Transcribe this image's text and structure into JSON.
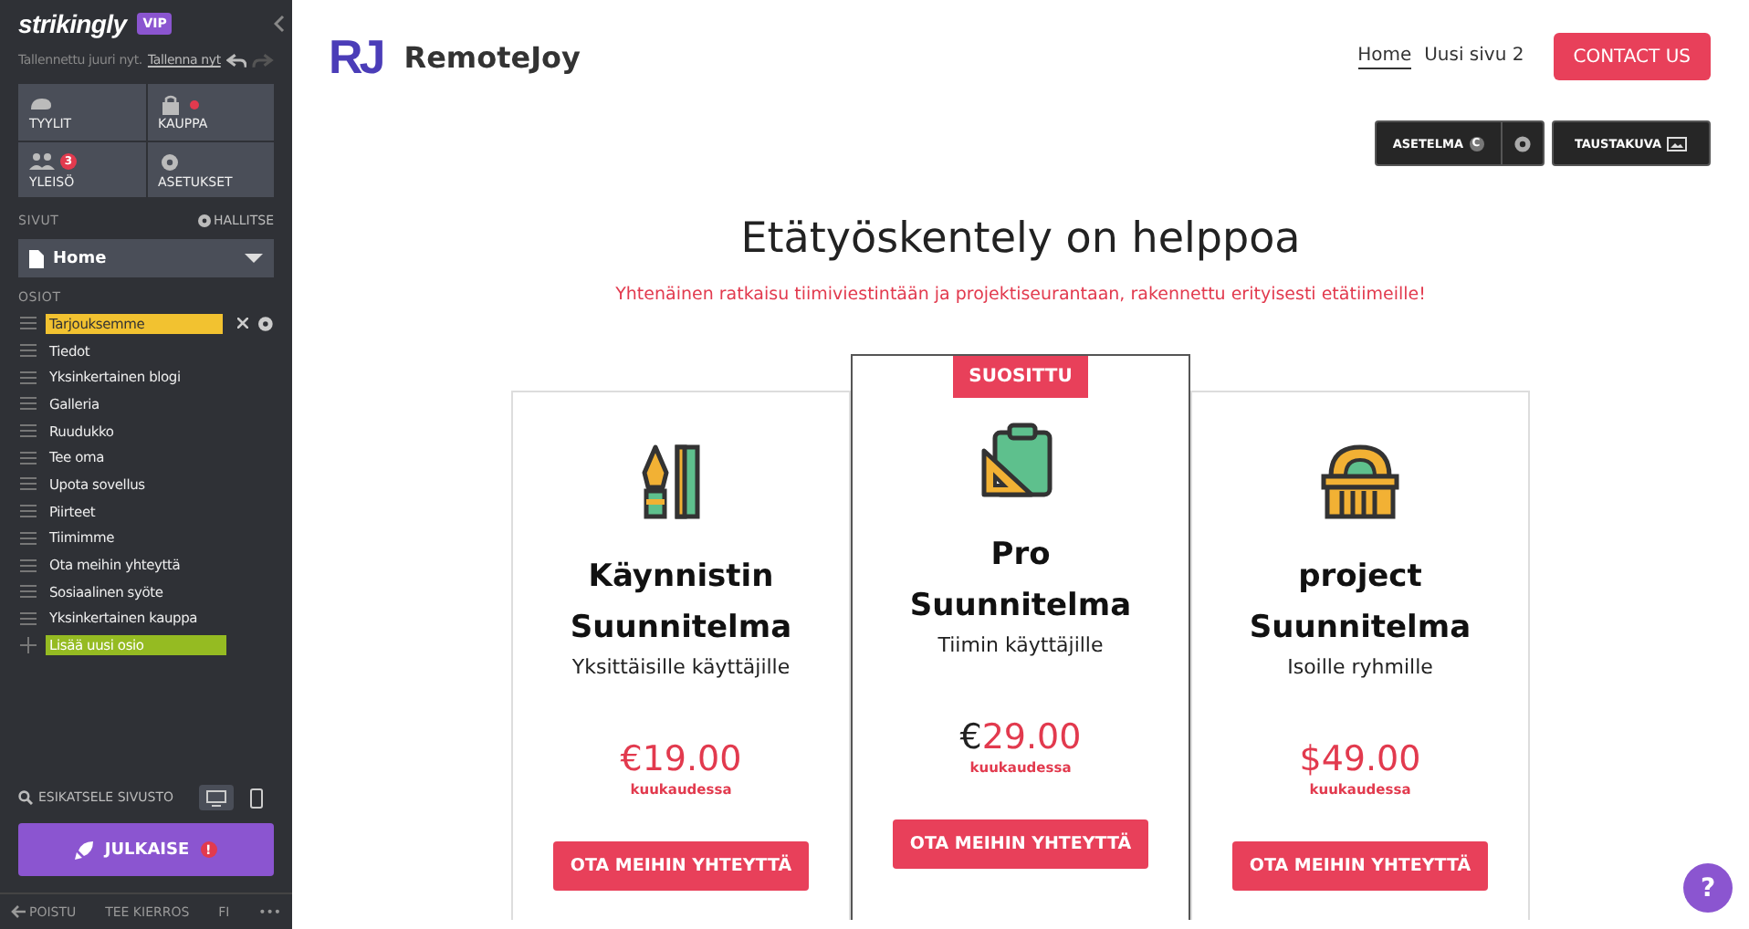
{
  "sidebar": {
    "logo": "strikingly",
    "badge": "VIP",
    "save_status": "Tallennettu juuri nyt.",
    "save_link": "Tallenna nyt",
    "tiles": [
      {
        "kind": "styles",
        "label": "TYYLIT"
      },
      {
        "kind": "store",
        "label": "KAUPPA",
        "dot": true
      },
      {
        "kind": "audience",
        "label": "YLEISÖ",
        "count": "3"
      },
      {
        "kind": "settings",
        "label": "ASETUKSET"
      }
    ],
    "pages_label": "SIVUT",
    "manage_label": "HALLITSE",
    "page_select": "Home",
    "sections_label": "OSIOT",
    "sections": [
      {
        "kind": "section",
        "label": "Tarjouksemme",
        "selected": true
      },
      {
        "kind": "section",
        "label": "Tiedot",
        "selected": false
      },
      {
        "kind": "section",
        "label": "Yksinkertainen blogi",
        "selected": false
      },
      {
        "kind": "section",
        "label": "Galleria",
        "selected": false
      },
      {
        "kind": "section",
        "label": "Ruudukko",
        "selected": false
      },
      {
        "kind": "section",
        "label": "Tee oma",
        "selected": false
      },
      {
        "kind": "section",
        "label": "Upota sovellus",
        "selected": false
      },
      {
        "kind": "section",
        "label": "Piirteet",
        "selected": false
      },
      {
        "kind": "section",
        "label": "Tiimimme",
        "selected": false
      },
      {
        "kind": "section",
        "label": "Ota meihin yhteyttä",
        "selected": false
      },
      {
        "kind": "section",
        "label": "Sosiaalinen syöte",
        "selected": false
      },
      {
        "kind": "section",
        "label": "Yksinkertainen kauppa",
        "selected": false
      },
      {
        "kind": "add",
        "label": "Lisää uusi osio"
      }
    ],
    "preview_label": "ESIKATSELE SIVUSTO",
    "devices": [
      {
        "kind": "desktop",
        "selected": true
      },
      {
        "kind": "mobile",
        "selected": false
      }
    ],
    "publish": "JULKAISE",
    "publish_alert": "!",
    "footer": [
      {
        "kind": "exit",
        "label": "POISTU"
      },
      {
        "kind": "text",
        "label": "TEE KIERROS"
      },
      {
        "kind": "text",
        "label": "FI"
      },
      {
        "kind": "text",
        "label": "•••"
      }
    ]
  },
  "site": {
    "logo_mark": "RJ",
    "brand": "RemoteJoy",
    "nav": [
      {
        "label": "Home",
        "selected": true
      },
      {
        "label": "Uusi sivu 2",
        "selected": false
      }
    ],
    "contact": "CONTACT US",
    "editor_buttons": [
      {
        "kind": "layout",
        "label": "ASETELMA",
        "badge": "C"
      },
      {
        "kind": "gear"
      },
      {
        "kind": "background",
        "label": "TAUSTAKUVA"
      }
    ],
    "title": "Etätyöskentely on helppoa",
    "subtitle": "Yhtenäinen ratkaisu tiimiviestintään ja projektiseurantaan, rakennettu erityisesti etätiimeille!",
    "plans": [
      {
        "name": "Käynnistin Suunnitelma",
        "audience": "Yksittäisille käyttäjille",
        "currency": "€",
        "amount": "19.00",
        "period": "kuukaudessa",
        "button": "OTA MEIHIN YHTEYTTÄ",
        "featured": false
      },
      {
        "name": "Pro Suunnitelma",
        "audience": "Tiimin käyttäjille",
        "currency": "€",
        "amount": "29.00",
        "period": "kuukaudessa",
        "button": "OTA MEIHIN YHTEYTTÄ",
        "featured": true,
        "ribbon": "SUOSITTU"
      },
      {
        "name": "project Suunnitelma",
        "audience": "Isoille ryhmille",
        "currency": "$",
        "amount": "49.00",
        "period": "kuukaudessa",
        "button": "OTA MEIHIN YHTEYTTÄ",
        "featured": false
      }
    ],
    "help": "?"
  }
}
